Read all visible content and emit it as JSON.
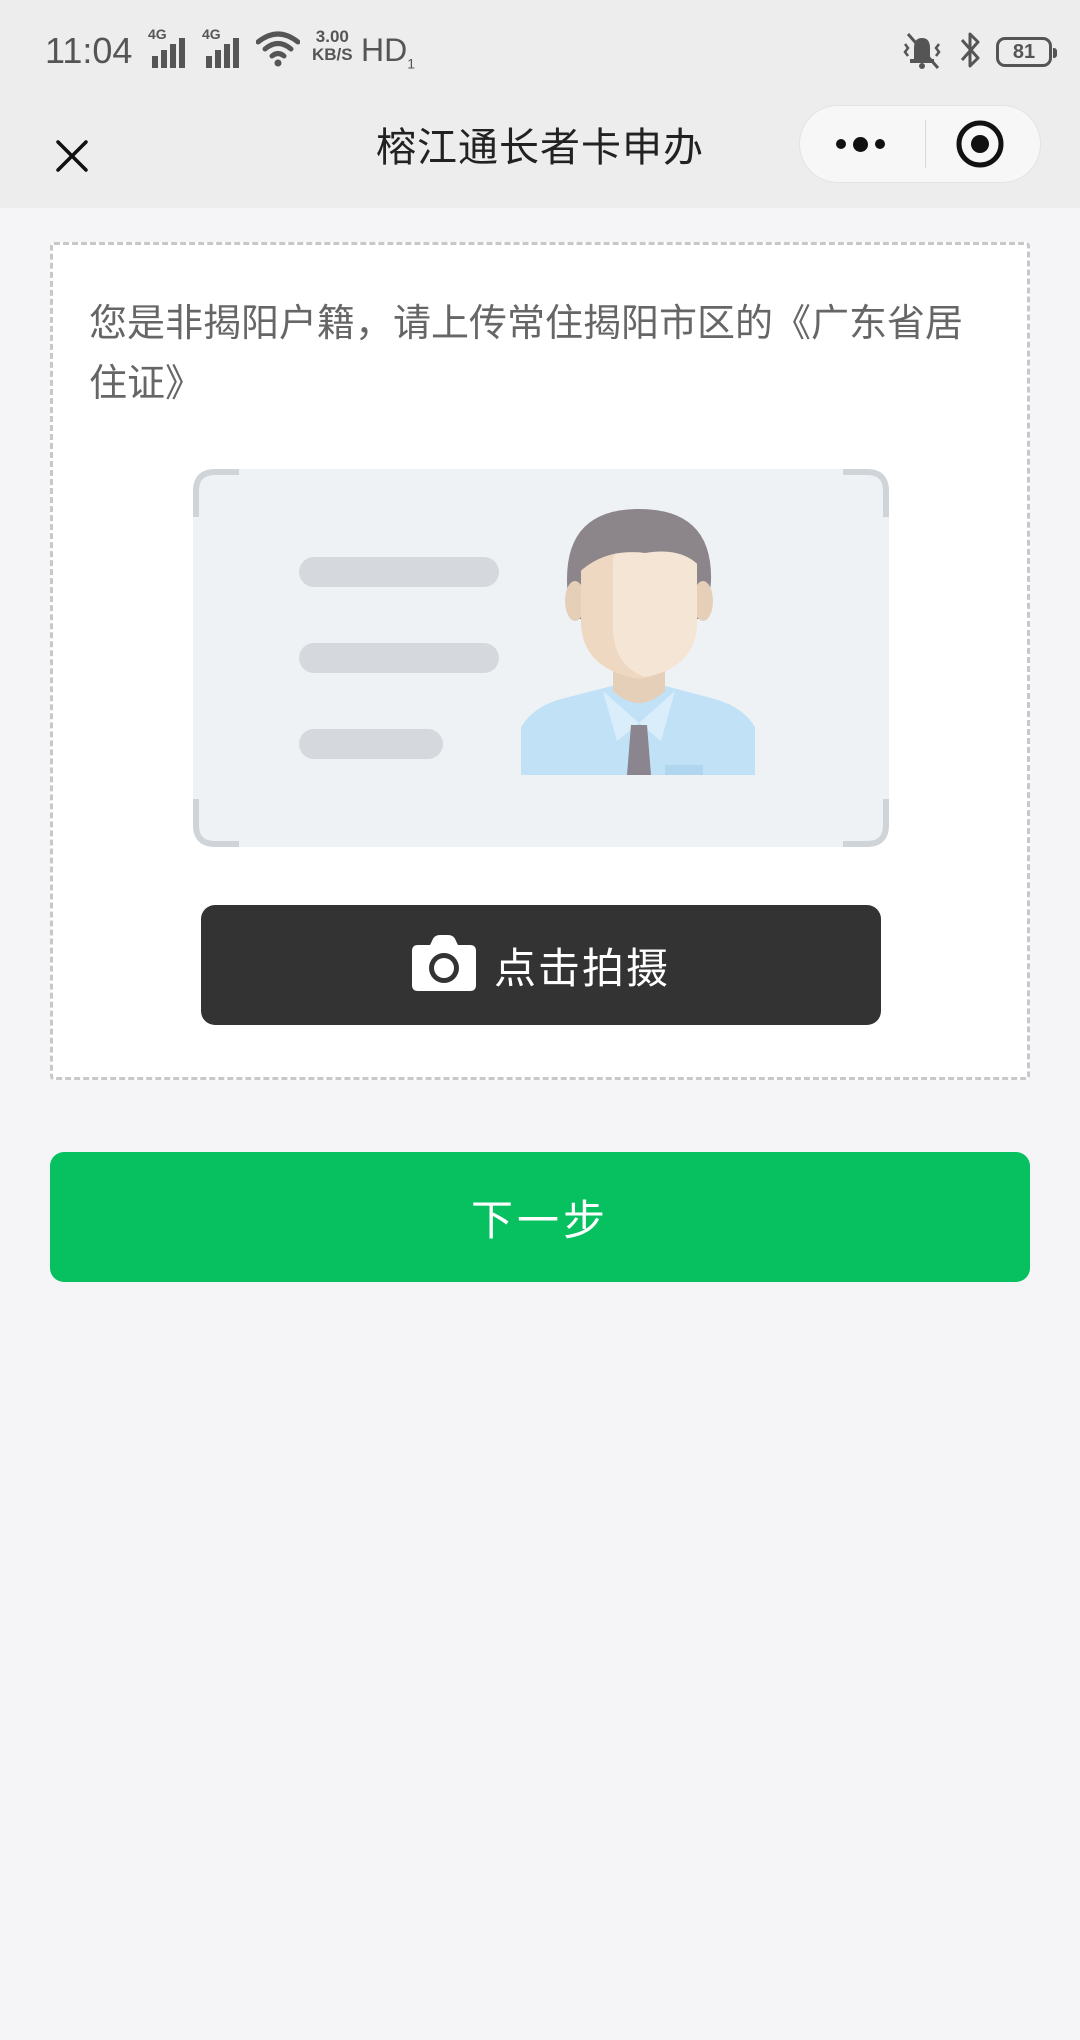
{
  "status_bar": {
    "time": "11:04",
    "network_1": "4G",
    "network_2": "4G",
    "speed_value": "3.00",
    "speed_unit": "KB/S",
    "hd_label": "HD",
    "hd_sub": "1",
    "battery": "81"
  },
  "nav": {
    "title": "榕江通长者卡申办",
    "close_icon": "close-icon",
    "more_icon": "more-dots-icon",
    "target_icon": "target-icon"
  },
  "card": {
    "instruction": "您是非揭阳户籍，请上传常住揭阳市区的《广东省居住证》",
    "shoot_button_label": "点击拍摄",
    "camera_icon": "camera-icon"
  },
  "next_button_label": "下一步",
  "colors": {
    "primary_green": "#07c160",
    "dark_button": "#333333",
    "page_background": "#f5f5f7"
  }
}
